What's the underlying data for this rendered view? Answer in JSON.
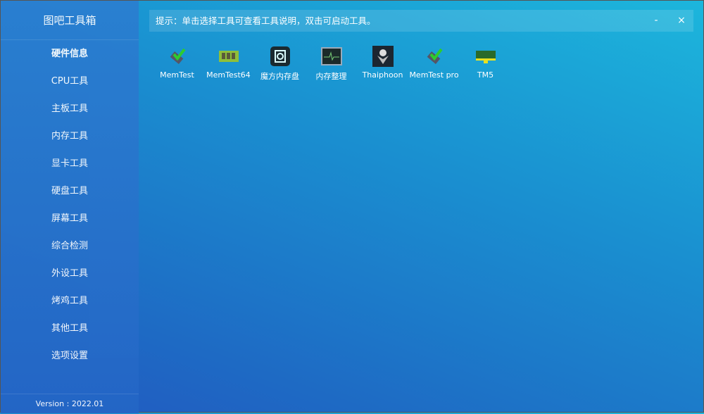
{
  "app": {
    "title": "图吧工具箱",
    "version": "Version : 2022.01"
  },
  "sidebar": {
    "items": [
      {
        "label": "硬件信息"
      },
      {
        "label": "CPU工具"
      },
      {
        "label": "主板工具"
      },
      {
        "label": "内存工具"
      },
      {
        "label": "显卡工具"
      },
      {
        "label": "硬盘工具"
      },
      {
        "label": "屏幕工具"
      },
      {
        "label": "综合检测"
      },
      {
        "label": "外设工具"
      },
      {
        "label": "烤鸡工具"
      },
      {
        "label": "其他工具"
      },
      {
        "label": "选项设置"
      }
    ]
  },
  "hint": "提示：单击选择工具可查看工具说明，双击可启动工具。",
  "window": {
    "minimize": "-",
    "close": "×"
  },
  "tools": [
    {
      "label": "MemTest",
      "icon": "chip-check-icon"
    },
    {
      "label": "MemTest64",
      "icon": "ram-icon"
    },
    {
      "label": "魔方内存盘",
      "icon": "ramdisk-icon"
    },
    {
      "label": "内存整理",
      "icon": "monitor-pulse-icon"
    },
    {
      "label": "Thaiphoon",
      "icon": "thaiphoon-icon"
    },
    {
      "label": "MemTest pro",
      "icon": "chip-check-icon"
    },
    {
      "label": "TM5",
      "icon": "ram-yellow-icon"
    }
  ]
}
